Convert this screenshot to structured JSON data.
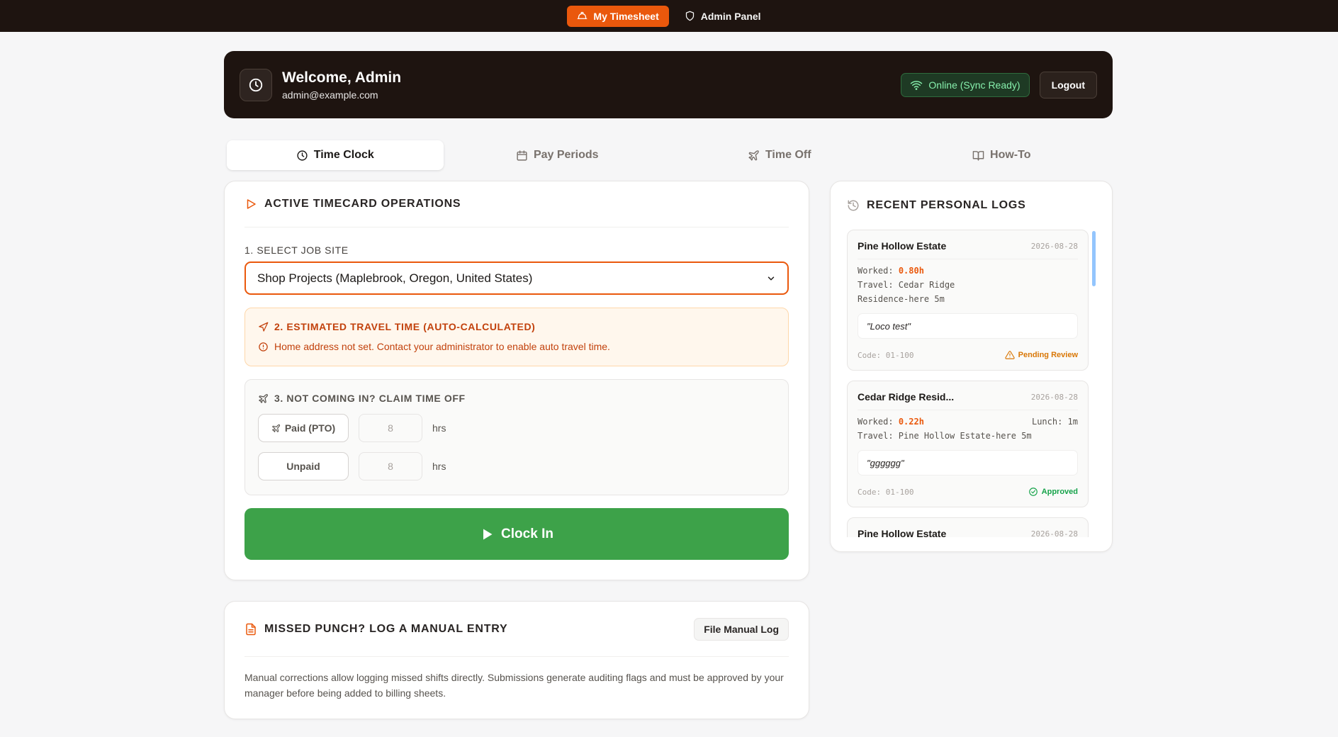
{
  "nav": {
    "my_timesheet": "My Timesheet",
    "admin_panel": "Admin Panel"
  },
  "header": {
    "title": "Welcome, Admin",
    "email": "admin@example.com",
    "status": "Online (Sync Ready)",
    "logout": "Logout"
  },
  "tabs": [
    {
      "label": "Time Clock",
      "icon": "clock-icon",
      "active": true
    },
    {
      "label": "Pay Periods",
      "icon": "calendar-icon"
    },
    {
      "label": "Time Off",
      "icon": "plane-icon"
    },
    {
      "label": "How-To",
      "icon": "book-icon"
    }
  ],
  "operations": {
    "title": "ACTIVE TIMECARD OPERATIONS",
    "job_site_label": "1. SELECT JOB SITE",
    "job_site_value": "Shop Projects (Maplebrook, Oregon, United States)",
    "travel_title": "2. ESTIMATED TRAVEL TIME (AUTO-CALCULATED)",
    "travel_message": "Home address not set. Contact your administrator to enable auto travel time.",
    "timeoff_title": "3. NOT COMING IN? CLAIM TIME OFF",
    "paid_label": "Paid (PTO)",
    "paid_hours": "8",
    "unpaid_label": "Unpaid",
    "unpaid_hours": "8",
    "hours_unit": "hrs",
    "clock_in": "Clock In"
  },
  "manual": {
    "title": "MISSED PUNCH? LOG A MANUAL ENTRY",
    "button": "File Manual Log",
    "description": "Manual corrections allow logging missed shifts directly. Submissions generate auditing flags and must be approved by your manager before being added to billing sheets."
  },
  "logs": {
    "title": "RECENT PERSONAL LOGS",
    "items": [
      {
        "site": "Pine Hollow Estate",
        "date": "2026-08-28",
        "worked_label": "Worked:",
        "worked": "0.80h",
        "travel_line1": "Travel: Cedar Ridge",
        "travel_line2": "Residence-here 5m",
        "note": "\"Loco test\"",
        "code": "Code: 01-100",
        "status": "Pending Review"
      },
      {
        "site": "Cedar Ridge Resid...",
        "date": "2026-08-28",
        "worked_label": "Worked:",
        "worked": "0.22h",
        "lunch": "Lunch: 1m",
        "travel_line1": "Travel: Pine Hollow Estate-here 5m",
        "note": "\"gggggg\"",
        "code": "Code: 01-100",
        "status": "Approved"
      },
      {
        "site": "Pine Hollow Estate",
        "date": "2026-08-28"
      }
    ]
  },
  "colors": {
    "accent": "#ea580c",
    "dark": "#1e1410",
    "success": "#3da249"
  }
}
